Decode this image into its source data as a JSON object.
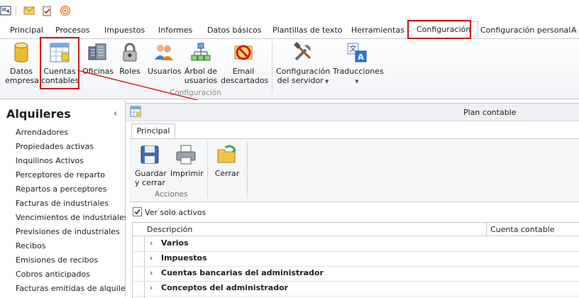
{
  "ribbon_tabs": [
    "Principal",
    "Procesos",
    "Impuestos",
    "Informes",
    "Datos básicos",
    "Plantillas de texto",
    "Herramientas",
    "Configuración",
    "Configuración personal",
    "A"
  ],
  "ribbon_buttons": [
    {
      "label": "Datos\nempresa",
      "icon": "database-icon"
    },
    {
      "label": "Cuentas\ncontables",
      "icon": "ledger-grid-icon"
    },
    {
      "label": "Oficinas",
      "icon": "offices-icon"
    },
    {
      "label": "Roles",
      "icon": "lock-icon"
    },
    {
      "label": "Usuarios",
      "icon": "users-icon"
    },
    {
      "label": "Árbol de\nusuarios",
      "icon": "tree-icon"
    },
    {
      "label": "Email\ndescartados",
      "icon": "email-blocked-icon"
    },
    {
      "label": "Configuración\ndel servidor",
      "icon": "tools-icon"
    },
    {
      "label": "Traducciones",
      "icon": "translate-icon"
    }
  ],
  "ribbon_group_label": "Configuración",
  "left_nav": {
    "title": "Alquileres",
    "collapse_glyph": "‹",
    "items": [
      "Arrendadores",
      "Propiedades activas",
      "Inquilinos Activos",
      "Perceptores de reparto",
      "Repartos a perceptores",
      "Facturas de industriales",
      "Vencimientos de industriales",
      "Previsiones de industriales",
      "Recibos",
      "Emisiones de recibos",
      "Cobros anticipados",
      "Facturas emitidas de alquiler"
    ]
  },
  "document": {
    "title": "Plan contable",
    "inner_tab": "Principal",
    "buttons": [
      {
        "label": "Guardar\ny cerrar",
        "icon": "save-icon"
      },
      {
        "label": "Imprimir",
        "icon": "printer-icon"
      },
      {
        "label": "Cerrar",
        "icon": "folder-close-icon"
      }
    ],
    "group_label": "Acciones",
    "checkbox_label": "Ver solo activos",
    "checkbox_checked": true,
    "grid": {
      "columns": [
        "Descripción",
        "Cuenta contable"
      ],
      "rows": [
        "Varios",
        "Impuestos",
        "Cuentas bancarias del administrador",
        "Conceptos del administrador"
      ]
    }
  },
  "colors": {
    "highlight": "#d11a1a",
    "accent": "#2b579a"
  }
}
